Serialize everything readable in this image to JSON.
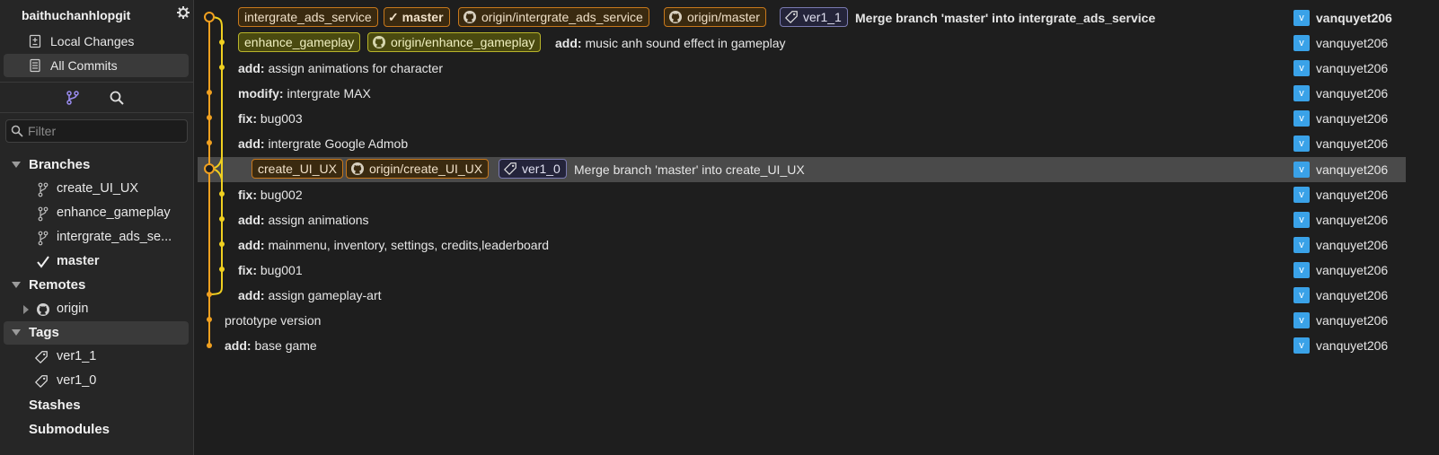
{
  "repo": {
    "name": "baithuchanhlopgit"
  },
  "nav": {
    "local_changes": "Local Changes",
    "all_commits": "All Commits"
  },
  "filter": {
    "placeholder": "Filter"
  },
  "sections": {
    "branches": "Branches",
    "remotes": "Remotes",
    "tags": "Tags",
    "stashes": "Stashes",
    "submodules": "Submodules"
  },
  "branches": [
    "create_UI_UX",
    "enhance_gameplay",
    "intergrate_ads_se...",
    "master"
  ],
  "current_branch_icon": "check-icon",
  "remotes": [
    "origin"
  ],
  "tags": [
    "ver1_1",
    "ver1_0"
  ],
  "commits": [
    {
      "refs": [
        "intergrate_ads_service",
        "master",
        "origin/intergrate_ads_service",
        "origin/master",
        "ver1_1"
      ],
      "message": "Merge branch 'master' into intergrate_ads_service",
      "author": "vanquyet206"
    },
    {
      "refs": [
        "enhance_gameplay",
        "origin/enhance_gameplay"
      ],
      "prefix": "add:",
      "message": " music anh sound effect in gameplay",
      "author": "vanquyet206"
    },
    {
      "prefix": "add:",
      "message": " assign animations for character",
      "author": "vanquyet206"
    },
    {
      "prefix": "modify:",
      "message": " intergrate MAX",
      "author": "vanquyet206"
    },
    {
      "prefix": "fix:",
      "message": " bug003",
      "author": "vanquyet206"
    },
    {
      "prefix": "add:",
      "message": " intergrate Google Admob",
      "author": "vanquyet206"
    },
    {
      "refs": [
        "create_UI_UX",
        "origin/create_UI_UX",
        "ver1_0"
      ],
      "message": "Merge branch 'master' into create_UI_UX",
      "author": "vanquyet206"
    },
    {
      "prefix": "fix:",
      "message": " bug002",
      "author": "vanquyet206"
    },
    {
      "prefix": "add:",
      "message": " assign animations",
      "author": "vanquyet206"
    },
    {
      "prefix": "add:",
      "message": " mainmenu, inventory, settings, credits,leaderboard",
      "author": "vanquyet206"
    },
    {
      "prefix": "fix:",
      "message": " bug001",
      "author": "vanquyet206"
    },
    {
      "prefix": "add:",
      "message": " assign gameplay-art",
      "author": "vanquyet206"
    },
    {
      "message": "prototype version",
      "author": "vanquyet206"
    },
    {
      "prefix": "add:",
      "message": " base game",
      "author": "vanquyet206"
    }
  ],
  "avatar_letter": "v",
  "colors": {
    "orange": "#f0a020",
    "yellow": "#f0d020",
    "avatar": "#3aa2e8"
  }
}
